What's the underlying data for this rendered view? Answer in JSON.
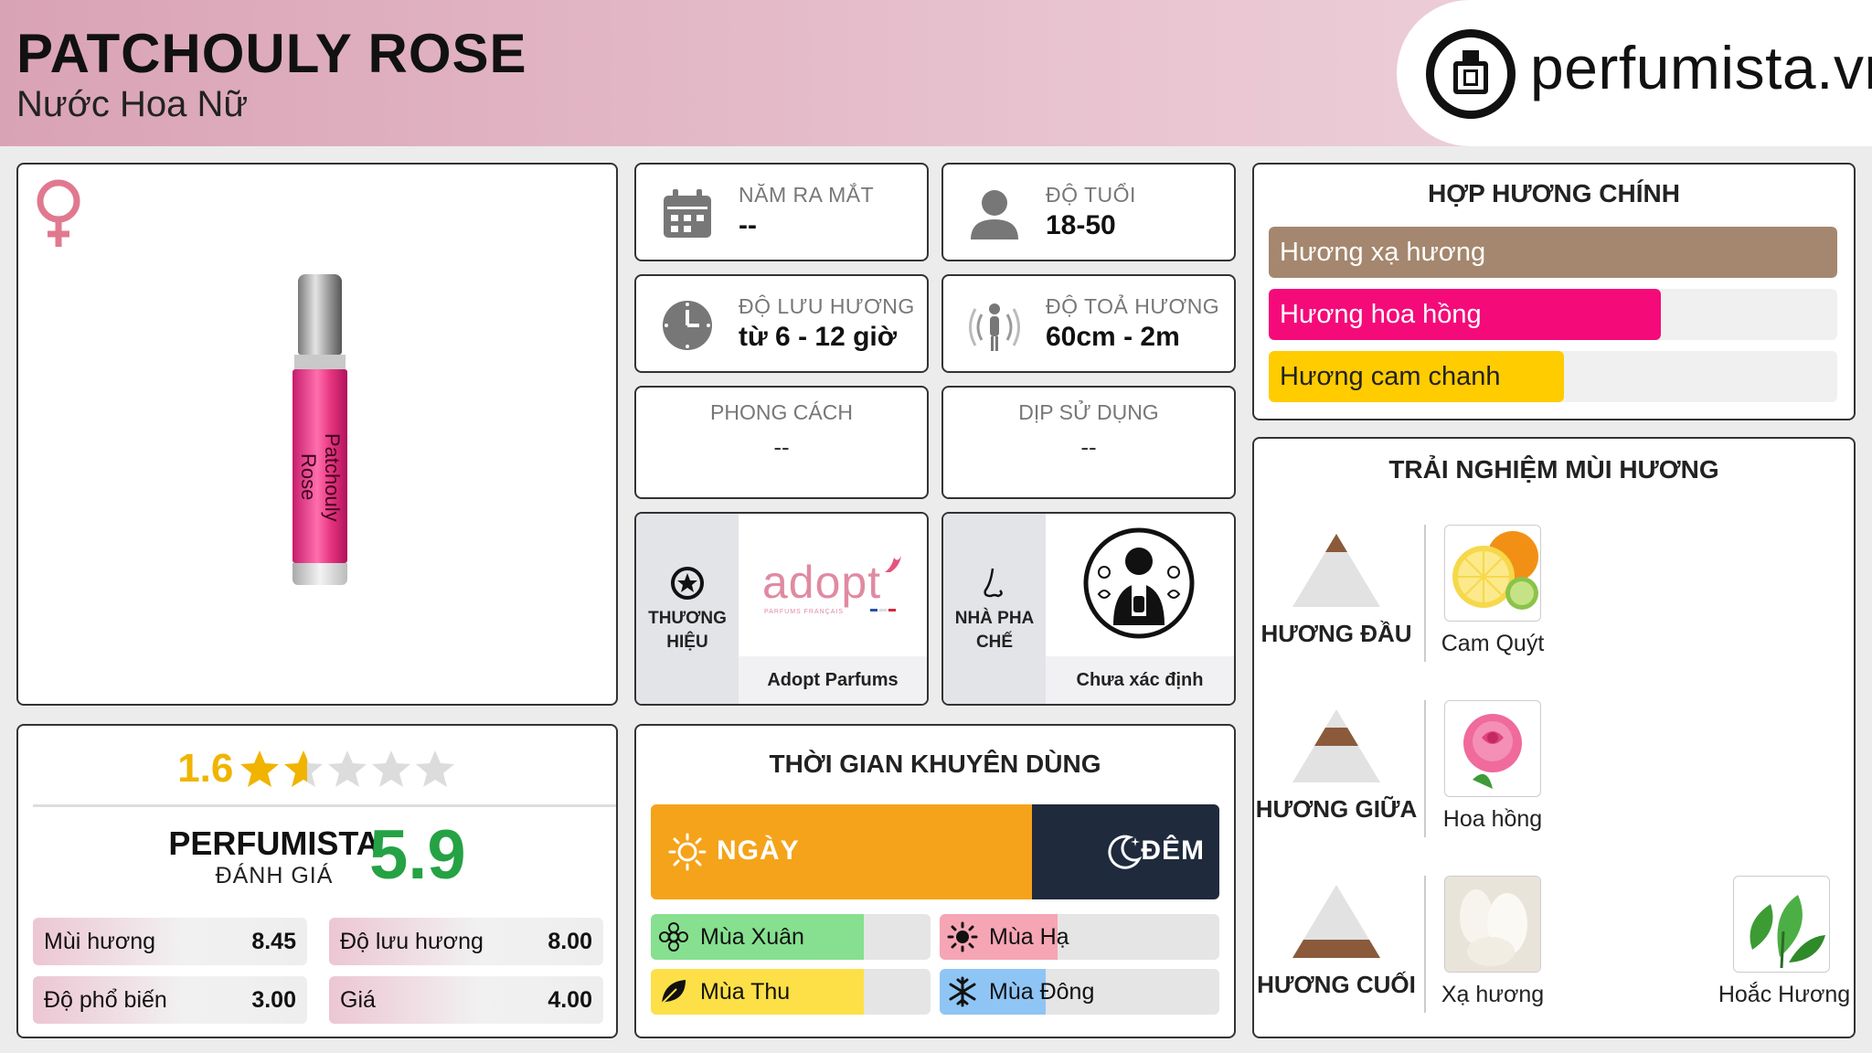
{
  "header": {
    "title": "PATCHOULY ROSE",
    "subtitle": "Nước Hoa Nữ",
    "logo_text": "perfumista.vn"
  },
  "product": {
    "gender_icon": "female-symbol-icon",
    "bottle_label": "Patchouly Rose"
  },
  "info": {
    "launch_year": {
      "label": "NĂM RA MẮT",
      "value": "--",
      "icon": "calendar-icon"
    },
    "age": {
      "label": "ĐỘ TUỔI",
      "value": "18-50",
      "icon": "person-icon"
    },
    "longevity": {
      "label": "ĐỘ LƯU HƯƠNG",
      "value": "từ 6 - 12 giờ",
      "icon": "clock-icon"
    },
    "sillage": {
      "label": "ĐỘ TOẢ HƯƠNG",
      "value": "60cm - 2m",
      "icon": "sillage-icon"
    },
    "style": {
      "label": "PHONG CÁCH",
      "value": "--"
    },
    "occasion": {
      "label": "DỊP SỬ DỤNG",
      "value": "--"
    }
  },
  "brand": {
    "label": "THƯƠNG HIỆU",
    "logo_text": "adopt",
    "logo_sub": "PARFUMS FRANÇAIS",
    "name": "Adopt Parfums",
    "icon": "star-badge-icon"
  },
  "perfumer": {
    "label": "NHÀ PHA CHẾ",
    "name": "Chưa xác định",
    "icon": "nose-icon"
  },
  "accords": {
    "title": "HỢP HƯƠNG CHÍNH",
    "items": [
      {
        "name": "Hương xạ hương",
        "level": 100,
        "color": "#a4876e"
      },
      {
        "name": "Hương hoa hồng",
        "level": 69,
        "color": "#f50a7a"
      },
      {
        "name": "Hương cam chanh",
        "level": 52,
        "color": "#ffcc00"
      }
    ]
  },
  "rating": {
    "user_score": "1.6",
    "user_stars_fraction": 0.32,
    "perfumista_label": "PERFUMISTA",
    "perfumista_sub": "ĐÁNH GIÁ",
    "perfumista_score": "5.9",
    "metrics": [
      {
        "label": "Mùi hương",
        "value": "8.45"
      },
      {
        "label": "Độ lưu hương",
        "value": "8.00"
      },
      {
        "label": "Độ phổ biến",
        "value": "3.00"
      },
      {
        "label": "Giá",
        "value": "4.00"
      }
    ]
  },
  "usage": {
    "title": "THỜI GIAN KHUYÊN DÙNG",
    "day_label": "NGÀY",
    "night_label": "ĐÊM",
    "day_fraction": 0.67,
    "seasons": [
      {
        "name": "Mùa Xuân",
        "level": 0.76,
        "color": "#86e08f",
        "icon": "flower-icon"
      },
      {
        "name": "Mùa Hạ",
        "level": 0.42,
        "color": "#f6a5b4",
        "icon": "sun-icon"
      },
      {
        "name": "Mùa Thu",
        "level": 0.76,
        "color": "#fde047",
        "icon": "leaf-icon"
      },
      {
        "name": "Mùa Đông",
        "level": 0.38,
        "color": "#8ec5f5",
        "icon": "snowflake-icon"
      }
    ]
  },
  "notes": {
    "title": "TRẢI NGHIỆM MÙI HƯƠNG",
    "top": {
      "label": "HƯƠNG ĐẦU",
      "items": [
        "Cam Quýt"
      ]
    },
    "middle": {
      "label": "HƯƠNG GIỮA",
      "items": [
        "Hoa hồng"
      ]
    },
    "base": {
      "label": "HƯƠNG CUỐI",
      "items": [
        "Xạ hương",
        "Hoắc Hương"
      ]
    }
  }
}
